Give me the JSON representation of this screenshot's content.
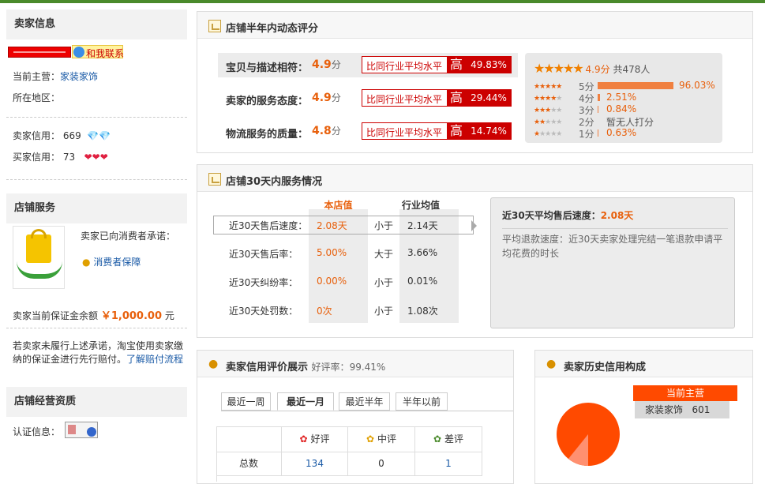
{
  "seller": {
    "title": "卖家信息",
    "contact_label": "和我联系",
    "main_label": "当前主营：",
    "main_value": "家装家饰",
    "region_label": "所在地区：",
    "seller_credit_label": "卖家信用：",
    "seller_credit_value": "669",
    "buyer_credit_label": "买家信用：",
    "buyer_credit_value": "73"
  },
  "service": {
    "title": "店铺服务",
    "promise_text": "卖家已向消费者承诺：",
    "guarantee_link": "消费者保障",
    "deposit_label": "卖家当前保证金余额",
    "deposit_value": "￥1,000.00",
    "deposit_unit": "元",
    "note_text1": "若卖家未履行上述承诺，淘宝使用卖家缴",
    "note_text2": "纳的保证金进行先行赔付。",
    "note_link": "了解赔付流程"
  },
  "qualification": {
    "title": "店铺经营资质",
    "cert_label": "认证信息："
  },
  "dynamic": {
    "title": "店铺半年内动态评分",
    "rows": [
      {
        "label": "宝贝与描述相符：",
        "score": "4.9",
        "unit": "分",
        "compare": "比同行业平均水平",
        "level": "高",
        "pct": "49.83%"
      },
      {
        "label": "卖家的服务态度：",
        "score": "4.9",
        "unit": "分",
        "compare": "比同行业平均水平",
        "level": "高",
        "pct": "29.44%"
      },
      {
        "label": "物流服务的质量：",
        "score": "4.8",
        "unit": "分",
        "compare": "比同行业平均水平",
        "level": "高",
        "pct": "14.74%"
      }
    ],
    "summary_score": "4.9分",
    "summary_count": "共478人",
    "dist": [
      {
        "label": "5分",
        "pct": "96.03%",
        "fraction": 0.9603
      },
      {
        "label": "4分",
        "pct": "2.51%",
        "fraction": 0.0251
      },
      {
        "label": "3分",
        "pct": "0.84%",
        "fraction": 0.0084
      },
      {
        "label": "2分",
        "pct": "暂无人打分",
        "fraction": 0
      },
      {
        "label": "1分",
        "pct": "0.63%",
        "fraction": 0.0063
      }
    ]
  },
  "service30": {
    "title": "店铺30天内服务情况",
    "col_store": "本店值",
    "col_avg": "行业均值",
    "rows": [
      {
        "label": "近30天售后速度：",
        "store": "2.08天",
        "cmp": "小于",
        "avg": "2.14天"
      },
      {
        "label": "近30天售后率：",
        "store": "5.00%",
        "cmp": "大于",
        "avg": "3.66%"
      },
      {
        "label": "近30天纠纷率：",
        "store": "0.00%",
        "cmp": "小于",
        "avg": "0.01%"
      },
      {
        "label": "近30天处罚数：",
        "store": "0次",
        "cmp": "小于",
        "avg": "1.08次"
      }
    ],
    "detail_title": "近30天平均售后速度：",
    "detail_value": "2.08天",
    "detail_desc1": "平均退款速度：近30天卖家处理完结一笔退款申请平",
    "detail_desc2": "均花费的时长"
  },
  "credit": {
    "title": "卖家信用评价展示",
    "rate_label": "好评率：",
    "rate_value": "99.41%",
    "tabs": [
      "最近一周",
      "最近一月",
      "最近半年",
      "半年以前"
    ],
    "headers": [
      "好评",
      "中评",
      "差评"
    ],
    "row_label": "总数",
    "row_values": [
      "134",
      "0",
      "1"
    ]
  },
  "history": {
    "title": "卖家历史信用构成",
    "tip_title": "当前主营",
    "tip_name": "家装家饰",
    "tip_value": "601"
  },
  "colors": {
    "accent": "#e8600c",
    "red": "#cc0000",
    "link": "#1a5aa6",
    "green": "#4a8a2b"
  }
}
